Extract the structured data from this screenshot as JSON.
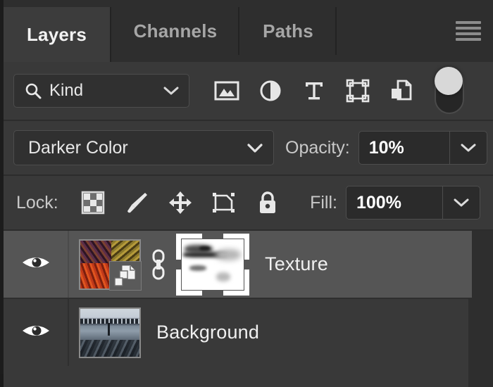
{
  "panel": {
    "title": "Layers",
    "menu_icon": "hamburger-menu-icon"
  },
  "tabs": [
    {
      "label": "Layers",
      "active": true
    },
    {
      "label": "Channels",
      "active": false
    },
    {
      "label": "Paths",
      "active": false
    }
  ],
  "filter_bar": {
    "kind_label": "Kind",
    "search_icon": "search-icon",
    "chevron_icon": "chevron-down-icon",
    "filter_icons": [
      "pixel-layer-filter-icon",
      "adjustment-layer-filter-icon",
      "type-layer-filter-icon",
      "shape-layer-filter-icon",
      "smart-object-filter-icon"
    ],
    "toggle_state": "off",
    "toggle_name": "filter-enable-toggle"
  },
  "blend_bar": {
    "blend_mode": "Darker Color",
    "opacity_label": "Opacity:",
    "opacity_value": "10%"
  },
  "lock_bar": {
    "lock_label": "Lock:",
    "lock_icons": [
      "lock-transparent-pixels-icon",
      "lock-image-pixels-icon",
      "lock-position-icon",
      "lock-artboard-nesting-icon",
      "lock-all-icon"
    ],
    "fill_label": "Fill:",
    "fill_value": "100%"
  },
  "layers": [
    {
      "name": "Texture",
      "visible": true,
      "selected": true,
      "visibility_icon": "eye-icon",
      "thumbnail": "texture-thumbnail",
      "smart_object_badge": "smart-object-badge-icon",
      "link_icon": "link-mask-icon",
      "mask_thumbnail": "layer-mask-thumbnail",
      "mask_selected": true
    },
    {
      "name": "Background",
      "visible": true,
      "selected": false,
      "visibility_icon": "eye-icon",
      "thumbnail": "background-photo-thumbnail"
    }
  ],
  "colors": {
    "panel_bg": "#393939",
    "tabbar_bg": "#2e2e2e",
    "tab_active_bg": "#3c3c3c",
    "row_selected_bg": "#555555",
    "text_primary": "#f0f0f0",
    "text_muted": "#a6a6a6",
    "field_bg": "#303030",
    "field_border": "#4d4d4d"
  }
}
